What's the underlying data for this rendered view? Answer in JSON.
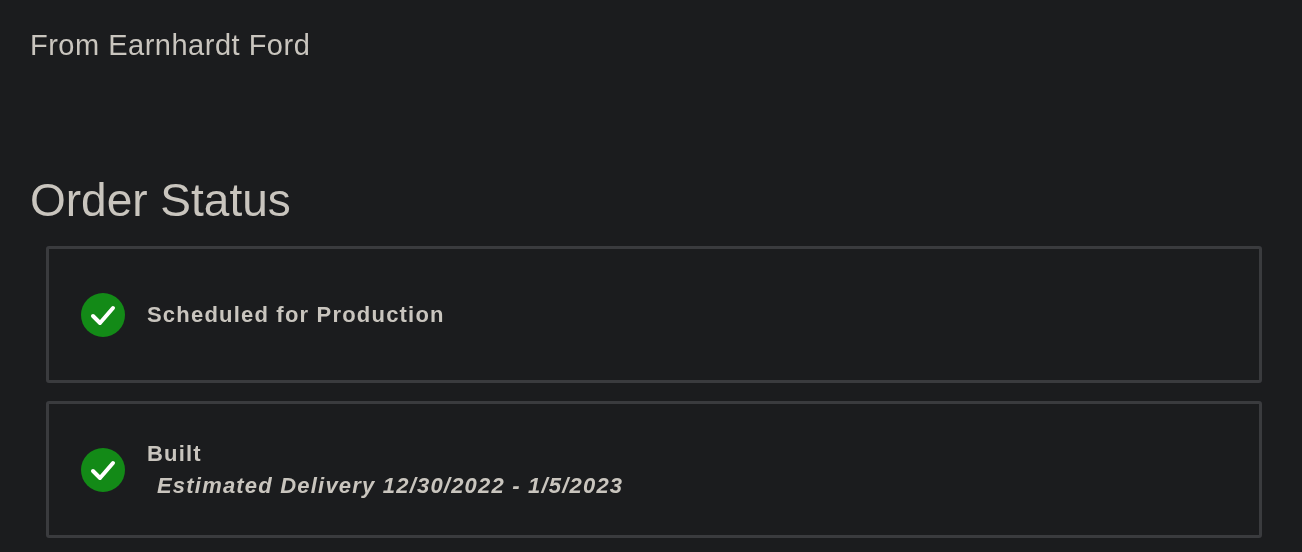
{
  "dealer": "From Earnhardt Ford",
  "heading": "Order Status",
  "steps": [
    {
      "title": "Scheduled for Production",
      "completed": true
    },
    {
      "title": "Built",
      "detail": "Estimated Delivery 12/30/2022 - 1/5/2023",
      "completed": true
    }
  ]
}
